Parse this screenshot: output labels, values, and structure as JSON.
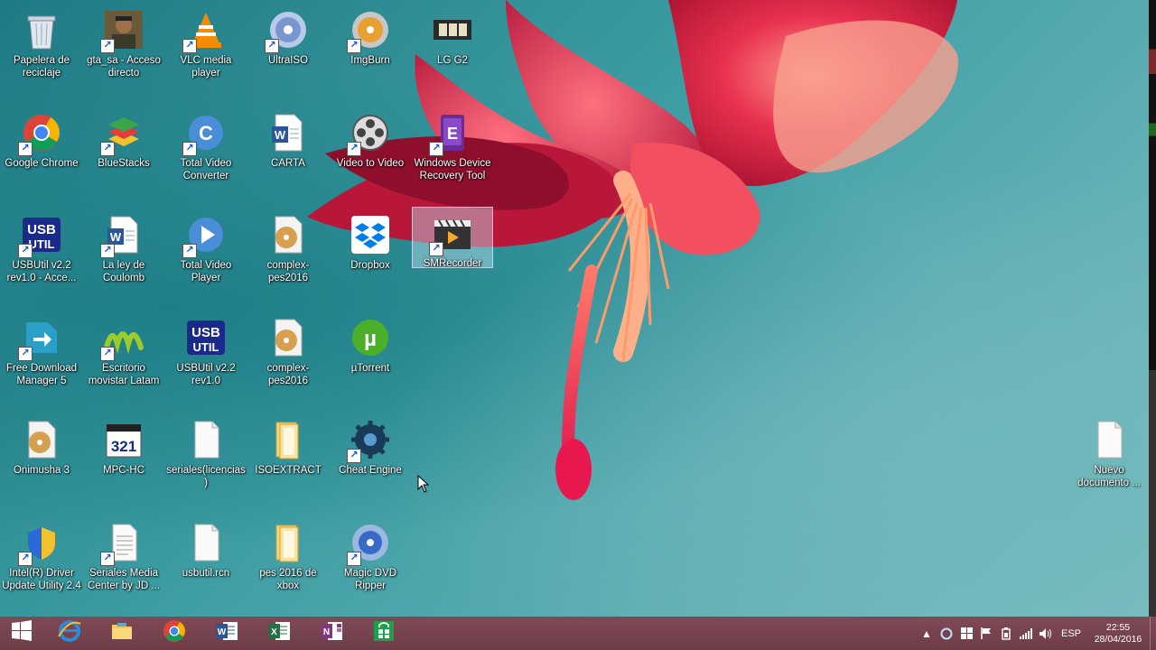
{
  "desktop": {
    "icons": [
      {
        "label": "Papelera de reciclaje",
        "icon": "recycle-bin-icon",
        "col": 0,
        "row": 0,
        "shortcut": false
      },
      {
        "label": "gta_sa - Acceso directo",
        "icon": "gta-icon",
        "col": 1,
        "row": 0,
        "shortcut": true
      },
      {
        "label": "VLC media player",
        "icon": "vlc-icon",
        "col": 2,
        "row": 0,
        "shortcut": true
      },
      {
        "label": "UltraISO",
        "icon": "ultraiso-icon",
        "col": 3,
        "row": 0,
        "shortcut": true
      },
      {
        "label": "ImgBurn",
        "icon": "imgburn-icon",
        "col": 4,
        "row": 0,
        "shortcut": true
      },
      {
        "label": "LG G2",
        "icon": "film-strip-icon",
        "col": 5,
        "row": 0,
        "shortcut": false
      },
      {
        "label": "Google Chrome",
        "icon": "chrome-icon",
        "col": 0,
        "row": 1,
        "shortcut": true
      },
      {
        "label": "BlueStacks",
        "icon": "bluestacks-icon",
        "col": 1,
        "row": 1,
        "shortcut": true
      },
      {
        "label": "Total Video Converter",
        "icon": "total-video-converter-icon",
        "col": 2,
        "row": 1,
        "shortcut": true
      },
      {
        "label": "CARTA",
        "icon": "word-document-icon",
        "col": 3,
        "row": 1,
        "shortcut": false
      },
      {
        "label": "Video to Video",
        "icon": "film-reel-icon",
        "col": 4,
        "row": 1,
        "shortcut": true
      },
      {
        "label": "Windows Device Recovery Tool",
        "icon": "device-recovery-icon",
        "col": 5,
        "row": 1,
        "shortcut": true
      },
      {
        "label": "USBUtil v2.2 rev1.0 - Acce...",
        "icon": "usbutil-icon",
        "col": 0,
        "row": 2,
        "shortcut": true
      },
      {
        "label": "La ley de Coulomb",
        "icon": "word-document-icon",
        "col": 1,
        "row": 2,
        "shortcut": true
      },
      {
        "label": "Total Video Player",
        "icon": "total-video-player-icon",
        "col": 2,
        "row": 2,
        "shortcut": true
      },
      {
        "label": "complex-pes2016",
        "icon": "disc-image-icon",
        "col": 3,
        "row": 2,
        "shortcut": false
      },
      {
        "label": "Dropbox",
        "icon": "dropbox-icon",
        "col": 4,
        "row": 2,
        "shortcut": false
      },
      {
        "label": "SMRecorder",
        "icon": "smrecorder-icon",
        "col": 5,
        "row": 2,
        "shortcut": true,
        "selected": true
      },
      {
        "label": "Free Download Manager 5",
        "icon": "fdm-icon",
        "col": 0,
        "row": 3,
        "shortcut": true
      },
      {
        "label": "Escritorio movistar Latam",
        "icon": "movistar-icon",
        "col": 1,
        "row": 3,
        "shortcut": true
      },
      {
        "label": "USBUtil v2.2 rev1.0",
        "icon": "usbutil-icon",
        "col": 2,
        "row": 3,
        "shortcut": false
      },
      {
        "label": "complex-pes2016",
        "icon": "disc-image-icon",
        "col": 3,
        "row": 3,
        "shortcut": false
      },
      {
        "label": "µTorrent",
        "icon": "utorrent-icon",
        "col": 4,
        "row": 3,
        "shortcut": false
      },
      {
        "label": "Onimusha 3",
        "icon": "disc-image-icon",
        "col": 0,
        "row": 4,
        "shortcut": false
      },
      {
        "label": "MPC-HC",
        "icon": "mpc-hc-icon",
        "col": 1,
        "row": 4,
        "shortcut": false
      },
      {
        "label": "seriales(licencias)",
        "icon": "blank-file-icon",
        "col": 2,
        "row": 4,
        "shortcut": false
      },
      {
        "label": "ISOEXTRACT",
        "icon": "folder-icon",
        "col": 3,
        "row": 4,
        "shortcut": false
      },
      {
        "label": "Cheat Engine",
        "icon": "cheat-engine-icon",
        "col": 4,
        "row": 4,
        "shortcut": true
      },
      {
        "label": "Intel(R) Driver Update Utility 2.4",
        "icon": "intel-driver-icon",
        "col": 0,
        "row": 5,
        "shortcut": true
      },
      {
        "label": "Seriales Media Center by JD ...",
        "icon": "text-file-icon",
        "col": 1,
        "row": 5,
        "shortcut": true
      },
      {
        "label": "usbutil.rcn",
        "icon": "blank-file-icon",
        "col": 2,
        "row": 5,
        "shortcut": false
      },
      {
        "label": "pes 2016 de xbox",
        "icon": "folder-icon",
        "col": 3,
        "row": 5,
        "shortcut": false
      },
      {
        "label": "Magic DVD Ripper",
        "icon": "dvd-ripper-icon",
        "col": 4,
        "row": 5,
        "shortcut": true
      },
      {
        "label": "Nuevo documento ...",
        "icon": "blank-file-icon",
        "col": 13,
        "row": 4,
        "shortcut": false
      }
    ]
  },
  "taskbar": {
    "pinned": [
      {
        "icon": "windows-start-icon",
        "active": false
      },
      {
        "icon": "internet-explorer-icon",
        "active": false
      },
      {
        "icon": "file-explorer-icon",
        "active": false
      },
      {
        "icon": "chrome-icon",
        "active": false
      },
      {
        "icon": "word-icon",
        "active": false
      },
      {
        "icon": "excel-icon",
        "active": false
      },
      {
        "icon": "onenote-icon",
        "active": false
      },
      {
        "icon": "store-icon",
        "active": false
      }
    ],
    "tray": {
      "language": "ESP",
      "time": "22:55",
      "date": "28/04/2016"
    }
  }
}
